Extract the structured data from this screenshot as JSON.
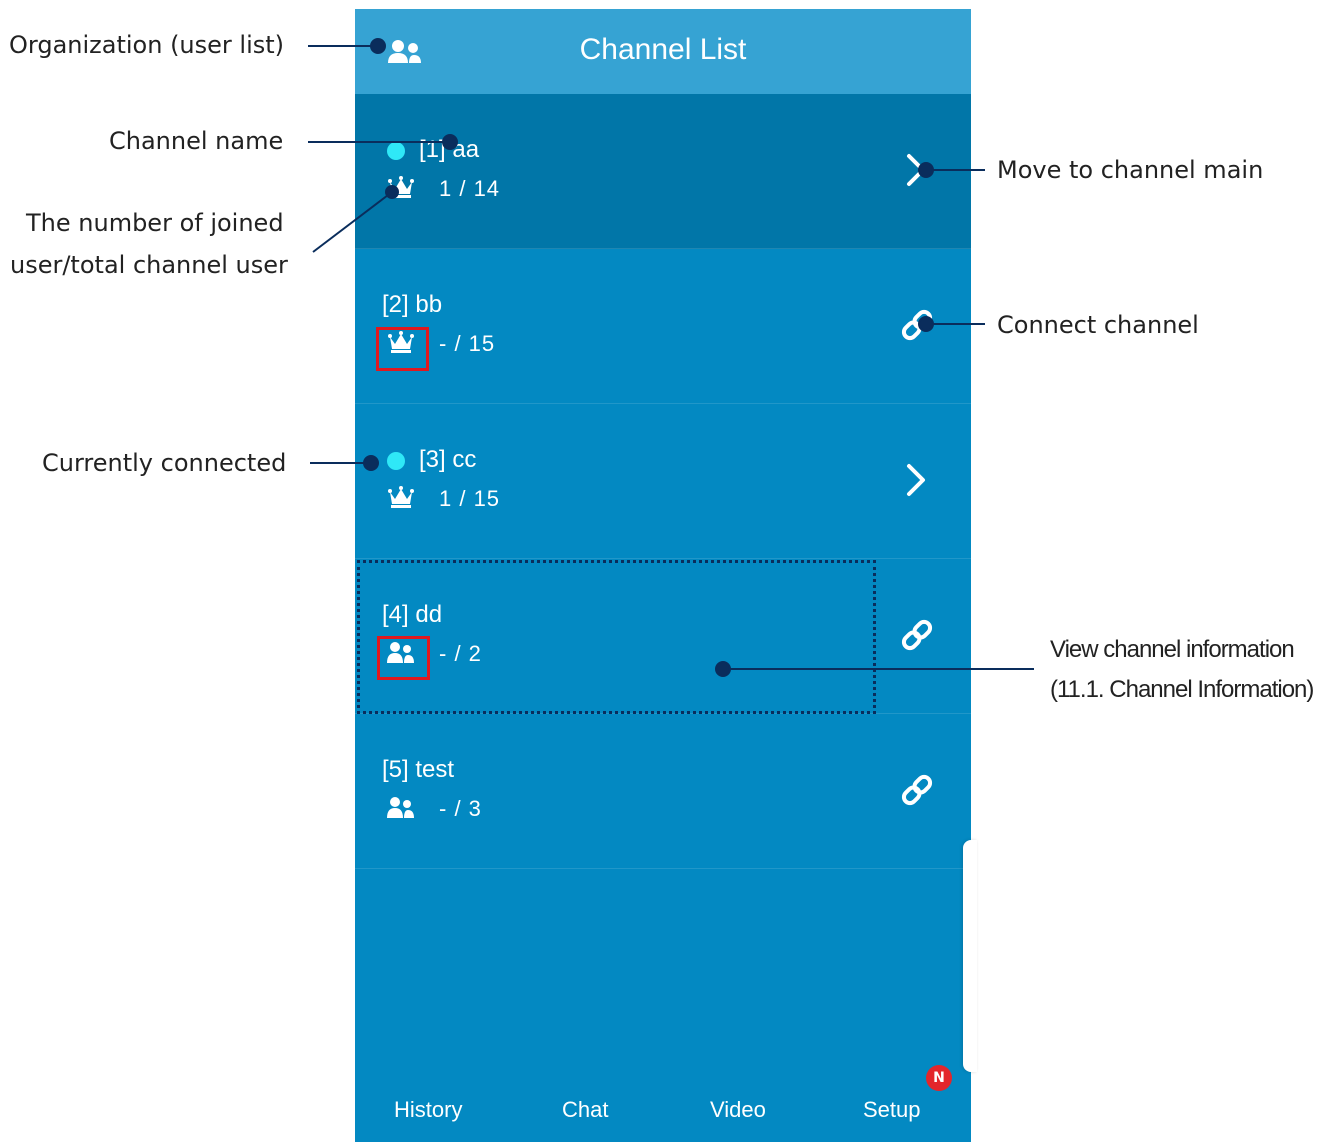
{
  "header": {
    "title": "Channel List",
    "org_icon": "users-icon"
  },
  "channels": [
    {
      "label": "[1] aa",
      "count": "1 / 14",
      "icon": "crown-icon",
      "connected": true,
      "action": "chevron-right-icon"
    },
    {
      "label": "[2] bb",
      "count": "- / 15",
      "icon": "crown-icon",
      "connected": false,
      "action": "link-icon"
    },
    {
      "label": "[3] cc",
      "count": "1 / 15",
      "icon": "crown-icon",
      "connected": true,
      "action": "chevron-right-icon"
    },
    {
      "label": "[4] dd",
      "count": "- / 2",
      "icon": "users-icon",
      "connected": false,
      "action": "link-icon"
    },
    {
      "label": "[5] test",
      "count": "- / 3",
      "icon": "users-icon",
      "connected": false,
      "action": "link-icon"
    }
  ],
  "tabs": [
    {
      "label": "History"
    },
    {
      "label": "Chat"
    },
    {
      "label": "Video"
    },
    {
      "label": "Setup"
    }
  ],
  "badge": "N",
  "annotations": {
    "organization": "Organization (user list)",
    "channel_name": "Channel name",
    "joined_line1": "The number of joined",
    "joined_line2": "user/total channel user",
    "connected": "Currently connected",
    "move_main": "Move to channel main",
    "connect_channel": "Connect channel",
    "view_info_line1": "View channel information",
    "view_info_line2": "(11.1. Channel Information)"
  },
  "colors": {
    "header": "#36a3d3",
    "list_bg": "#0389c2",
    "selected_row": "#0176a8",
    "connected_dot": "#2fe8f7",
    "badge": "#e3262b",
    "annotation_line": "#0a2d5c",
    "highlight_box": "#e0181f"
  }
}
